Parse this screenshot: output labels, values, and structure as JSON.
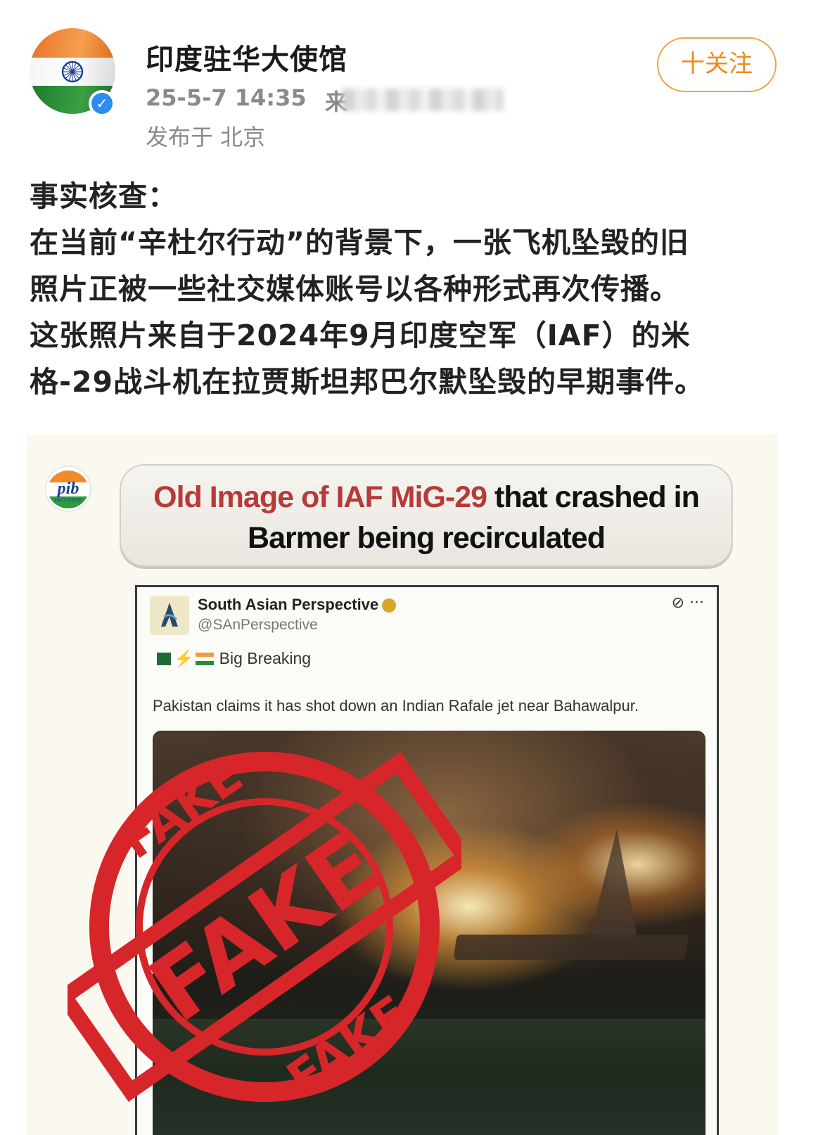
{
  "header": {
    "account_name": "印度驻华大使馆",
    "time": "25-5-7 14:35",
    "source_prefix": "来",
    "location": "发布于 北京",
    "follow_label": "十关注"
  },
  "post": {
    "lines": [
      "事实核查：",
      "在当前“辛杜尔行动”的背景下，一张飞机坠毁的旧",
      "照片正被一些社交媒体账号以各种形式再次传播。",
      "这张照片来自于2024年9月印度空军（IAF）的米",
      "格-29战斗机在拉贾斯坦邦巴尔默坠毁的早期事件。"
    ]
  },
  "image": {
    "logo_text": "pib",
    "logo_subtext": "FACT CHECK",
    "headline_red": "Old Image of IAF MiG-29",
    "headline_black_1": " that crashed in",
    "headline_black_2": "Barmer being recirculated",
    "tweet": {
      "name": "South Asian Perspective",
      "handle": "@SAnPerspective",
      "icons": "⊘ ···",
      "breaking": "Big Breaking",
      "text": "Pakistan claims it has shot down an Indian Rafale jet near Bahawalpur."
    },
    "stamp_word": "FAKE"
  },
  "colors": {
    "follow_accent": "#f08a1e",
    "verified": "#2d8cf0",
    "headline_red": "#b73a3a",
    "stamp_red": "#d6262a"
  }
}
